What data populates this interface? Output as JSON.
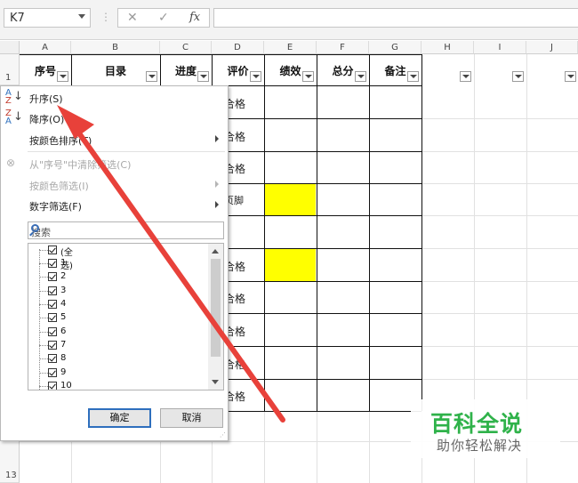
{
  "formula_bar": {
    "name_box": "K7",
    "cancel_glyph": "✕",
    "enter_glyph": "✓",
    "fx_glyph": "fx",
    "formula": ""
  },
  "columns": [
    "A",
    "B",
    "C",
    "D",
    "E",
    "F",
    "G",
    "H",
    "I",
    "J"
  ],
  "rows": {
    "first": "1",
    "last": "13"
  },
  "header_row": [
    "序号",
    "目录",
    "进度",
    "评价",
    "绩效",
    "总分",
    "备注"
  ],
  "evaluation_cells": [
    "合格",
    "合格",
    "合格",
    "页脚",
    "",
    "合格",
    "合格",
    "合格",
    "合格",
    "合格"
  ],
  "highlight_color": "#ffff00",
  "menu": {
    "sort_ascending": "升序(S)",
    "sort_descending": "降序(O)",
    "sort_by_color": "按颜色排序(T)",
    "clear_filter": "从\"序号\"中清除筛选(C)",
    "filter_by_color": "按颜色筛选(I)",
    "number_filters": "数字筛选(F)",
    "search_placeholder": "搜索",
    "values": [
      "(全选)",
      "1",
      "2",
      "3",
      "4",
      "5",
      "6",
      "7",
      "8",
      "9",
      "10"
    ],
    "ok": "确定",
    "cancel": "取消"
  },
  "watermark": {
    "title": "百科全说",
    "subtitle": "助你轻松解决"
  },
  "annotation_color": "#e8413a"
}
